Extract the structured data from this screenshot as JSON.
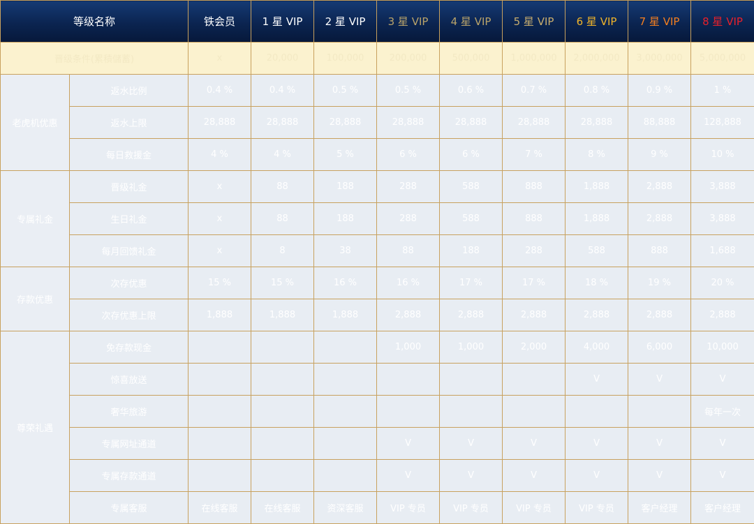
{
  "header": {
    "level_name": "等级名称",
    "columns": [
      {
        "label": "铁会员",
        "color": "#ffffff"
      },
      {
        "label": "1 星 VIP",
        "color": "#ffffff"
      },
      {
        "label": "2 星 VIP",
        "color": "#ffffff"
      },
      {
        "label": "3 星 VIP",
        "color": "#b9a36a"
      },
      {
        "label": "4 星 VIP",
        "color": "#b9a36a"
      },
      {
        "label": "5 星 VIP",
        "color": "#c8ad6e"
      },
      {
        "label": "6 星 VIP",
        "color": "#f0b42a"
      },
      {
        "label": "7 星 VIP",
        "color": "#f57f1f"
      },
      {
        "label": "8 星 VIP",
        "color": "#e8202a"
      }
    ]
  },
  "requirement": {
    "label": "晋级条件(累積儲蓄)",
    "values": [
      "x",
      "20,000",
      "100,000",
      "200,000",
      "500,000",
      "1,000,000",
      "2,000,000",
      "3,000,000",
      "5,000,000"
    ]
  },
  "sections": [
    {
      "name": "老虎机优惠",
      "rows": [
        {
          "label": "返水比例",
          "values": [
            "0.4 %",
            "0.4 %",
            "0.5 %",
            "0.5 %",
            "0.6 %",
            "0.7 %",
            "0.8 %",
            "0.9 %",
            "1 %"
          ]
        },
        {
          "label": "返水上限",
          "values": [
            "28,888",
            "28,888",
            "28,888",
            "28,888",
            "28,888",
            "28,888",
            "28,888",
            "88,888",
            "128,888"
          ]
        },
        {
          "label": "每日救援金",
          "values": [
            "4 %",
            "4 %",
            "5 %",
            "6 %",
            "6 %",
            "7 %",
            "8 %",
            "9 %",
            "10 %"
          ]
        }
      ]
    },
    {
      "name": "专属礼金",
      "rows": [
        {
          "label": "晋级礼金",
          "values": [
            "x",
            "88",
            "188",
            "288",
            "588",
            "888",
            "1,888",
            "2,888",
            "3,888"
          ]
        },
        {
          "label": "生日礼金",
          "values": [
            "x",
            "88",
            "188",
            "288",
            "588",
            "888",
            "1,888",
            "2,888",
            "3,888"
          ]
        },
        {
          "label": "每月回馈礼金",
          "values": [
            "x",
            "8",
            "38",
            "88",
            "188",
            "288",
            "588",
            "888",
            "1,688"
          ]
        }
      ]
    },
    {
      "name": "存款优惠",
      "rows": [
        {
          "label": "次存优惠",
          "values": [
            "15 %",
            "15 %",
            "16 %",
            "16 %",
            "17 %",
            "17 %",
            "18 %",
            "19 %",
            "20 %"
          ]
        },
        {
          "label": "次存优惠上限",
          "values": [
            "1,888",
            "1,888",
            "1,888",
            "2,888",
            "2,888",
            "2,888",
            "2,888",
            "2,888",
            "2,888"
          ]
        }
      ]
    },
    {
      "name": "尊荣礼遇",
      "rows": [
        {
          "label": "免存款现金",
          "values": [
            "",
            "",
            "",
            "1,000",
            "1,000",
            "2,000",
            "4,000",
            "6,000",
            "10,000"
          ]
        },
        {
          "label": "惊喜放送",
          "values": [
            "",
            "",
            "",
            "",
            "",
            "",
            "V",
            "V",
            "V"
          ]
        },
        {
          "label": "奢华旅游",
          "values": [
            "",
            "",
            "",
            "",
            "",
            "",
            "",
            "",
            "每年一次"
          ]
        },
        {
          "label": "专属网址通道",
          "values": [
            "",
            "",
            "",
            "V",
            "V",
            "V",
            "V",
            "V",
            "V"
          ]
        },
        {
          "label": "专属存款通道",
          "values": [
            "",
            "",
            "",
            "V",
            "V",
            "V",
            "V",
            "V",
            "V"
          ]
        },
        {
          "label": "专属客服",
          "values": [
            "在线客服",
            "在线客服",
            "资深客服",
            "VIP 专员",
            "VIP 专员",
            "VIP 专员",
            "VIP 专员",
            "客户经理",
            "客户经理"
          ]
        }
      ]
    }
  ]
}
